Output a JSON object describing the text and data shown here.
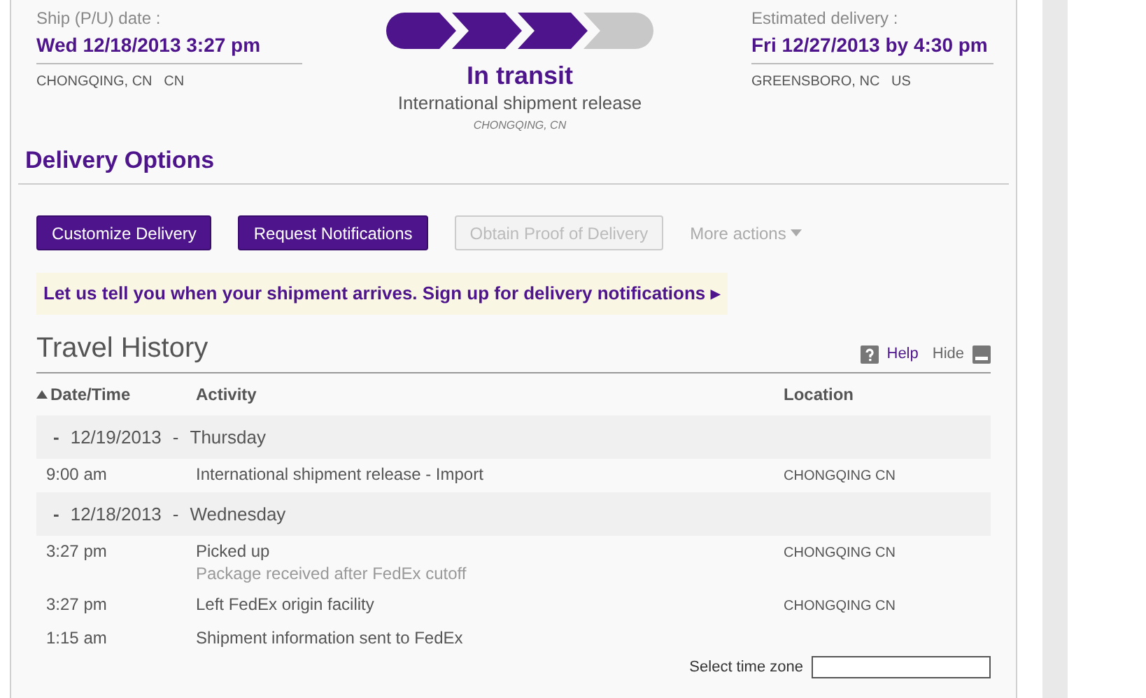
{
  "ship": {
    "label": "Ship (P/U) date :",
    "date": "Wed 12/18/2013 3:27 pm",
    "location": "CHONGQING, CN   CN"
  },
  "progress": {
    "steps": [
      {
        "done": true
      },
      {
        "done": true
      },
      {
        "done": true
      },
      {
        "done": false
      }
    ],
    "status": "In transit",
    "detail": "International shipment release",
    "location": "CHONGQING, CN"
  },
  "delivery": {
    "label": "Estimated delivery :",
    "date": "Fri 12/27/2013 by 4:30 pm",
    "location": "GREENSBORO, NC   US"
  },
  "delivery_options": {
    "title": "Delivery Options",
    "buttons": [
      {
        "label": "Customize Delivery",
        "disabled": false
      },
      {
        "label": "Request Notifications",
        "disabled": false
      },
      {
        "label": "Obtain Proof of Delivery",
        "disabled": true
      }
    ],
    "more_actions": "More actions",
    "banner": "Let us tell you when your shipment arrives. Sign up for delivery notifications ▸"
  },
  "travel_history": {
    "title": "Travel History",
    "help": "Help",
    "hide": "Hide",
    "columns": [
      "Date/Time",
      "Activity",
      "Location"
    ],
    "groups": [
      {
        "toggle": "-",
        "date": "12/19/2013",
        "separator": "-",
        "day": "Thursday",
        "rows": [
          {
            "time": "9:00 am",
            "activity": "International shipment release - Import",
            "location": "CHONGQING CN"
          }
        ]
      },
      {
        "toggle": "-",
        "date": "12/18/2013",
        "separator": "-",
        "day": "Wednesday",
        "rows": [
          {
            "time": "3:27 pm",
            "activity": "Picked up",
            "note": "Package received after FedEx cutoff",
            "location": "CHONGQING CN"
          },
          {
            "time": "3:27 pm",
            "activity": "Left FedEx origin facility",
            "location": "CHONGQING CN"
          },
          {
            "time": "1:15 am",
            "activity": "Shipment information sent to FedEx"
          }
        ]
      }
    ],
    "time_zone_label": "Select time zone"
  }
}
